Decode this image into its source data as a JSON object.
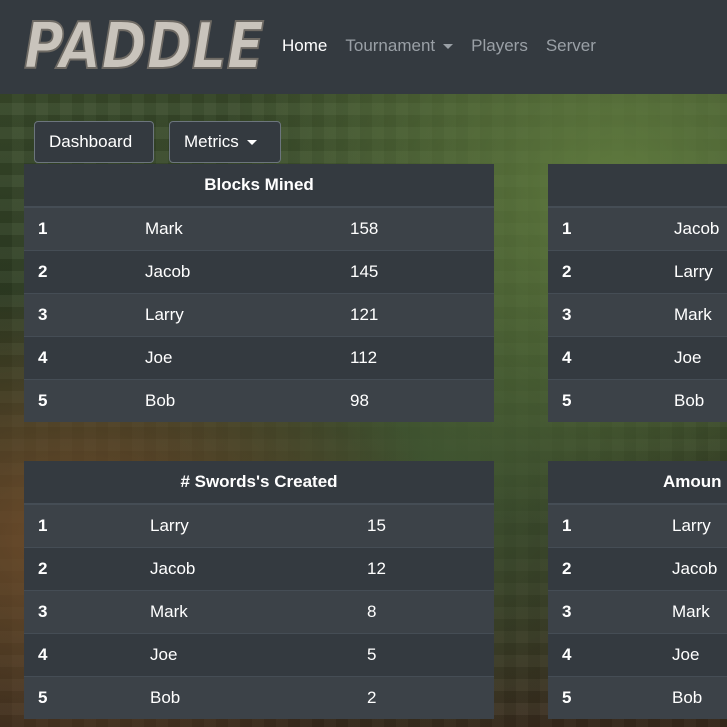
{
  "navbar": {
    "brand": "PADDLE",
    "links": [
      {
        "label": "Home",
        "active": true
      },
      {
        "label": "Tournament",
        "dropdown": true
      },
      {
        "label": "Players"
      },
      {
        "label": "Server"
      }
    ]
  },
  "toolbar": {
    "dashboard_label": "Dashboard",
    "metrics_label": "Metrics"
  },
  "tables": {
    "blocks_mined": {
      "title": "Blocks Mined",
      "rows": [
        {
          "rank": "1",
          "name": "Mark",
          "value": "158"
        },
        {
          "rank": "2",
          "name": "Jacob",
          "value": "145"
        },
        {
          "rank": "3",
          "name": "Larry",
          "value": "121"
        },
        {
          "rank": "4",
          "name": "Joe",
          "value": "112"
        },
        {
          "rank": "5",
          "name": "Bob",
          "value": "98"
        }
      ]
    },
    "top_right": {
      "title": "",
      "rows": [
        {
          "rank": "1",
          "name": "Jacob"
        },
        {
          "rank": "2",
          "name": "Larry"
        },
        {
          "rank": "3",
          "name": "Mark"
        },
        {
          "rank": "4",
          "name": "Joe"
        },
        {
          "rank": "5",
          "name": "Bob"
        }
      ]
    },
    "swords_created": {
      "title": "# Swords's Created",
      "rows": [
        {
          "rank": "1",
          "name": "Larry",
          "value": "15"
        },
        {
          "rank": "2",
          "name": "Jacob",
          "value": "12"
        },
        {
          "rank": "3",
          "name": "Mark",
          "value": "8"
        },
        {
          "rank": "4",
          "name": "Joe",
          "value": "5"
        },
        {
          "rank": "5",
          "name": "Bob",
          "value": "2"
        }
      ]
    },
    "bottom_right": {
      "title": "Amoun",
      "rows": [
        {
          "rank": "1",
          "name": "Larry"
        },
        {
          "rank": "2",
          "name": "Jacob"
        },
        {
          "rank": "3",
          "name": "Mark"
        },
        {
          "rank": "4",
          "name": "Joe"
        },
        {
          "rank": "5",
          "name": "Bob"
        }
      ]
    }
  },
  "colors": {
    "navbar": "#343a40",
    "card": "#343a40",
    "stripe": "#3c4248",
    "muted_text": "#9aa0a6"
  }
}
